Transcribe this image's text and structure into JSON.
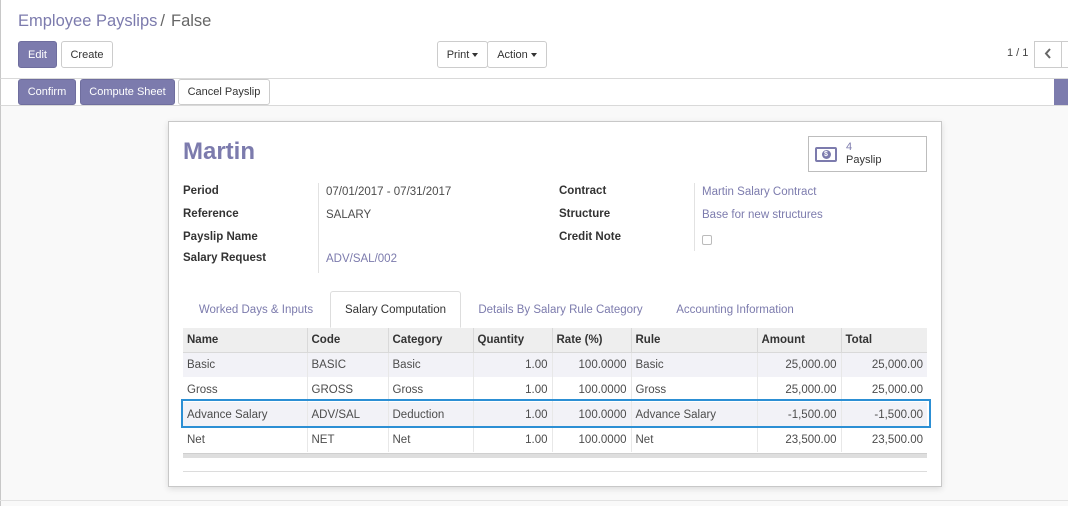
{
  "breadcrumb": {
    "parent": "Employee Payslips",
    "separator": "/",
    "current": "False"
  },
  "toolbar": {
    "edit_label": "Edit",
    "create_label": "Create",
    "print_label": "Print",
    "action_label": "Action"
  },
  "pager": {
    "value": "1 / 1",
    "prev_icon": "chevron-left-icon"
  },
  "status_buttons": {
    "confirm_label": "Confirm",
    "compute_label": "Compute Sheet",
    "cancel_label": "Cancel Payslip"
  },
  "colors": {
    "accent": "#7c7bad",
    "selection": "#2c8fd4"
  },
  "form": {
    "name": "Martin",
    "smart_button": {
      "icon": "money-icon",
      "count": "4",
      "label": "Payslip"
    },
    "fields": {
      "period_label": "Period",
      "period_value": "07/01/2017 - 07/31/2017",
      "reference_label": "Reference",
      "reference_value": "SALARY",
      "payslip_name_label": "Payslip Name",
      "payslip_name_value": "",
      "salary_request_label": "Salary Request",
      "salary_request_value": "ADV/SAL/002",
      "contract_label": "Contract",
      "contract_value": "Martin Salary Contract",
      "structure_label": "Structure",
      "structure_value": "Base for new structures",
      "credit_note_label": "Credit Note",
      "credit_note_checked": false
    },
    "tabs": [
      {
        "label": "Worked Days & Inputs",
        "active": false
      },
      {
        "label": "Salary Computation",
        "active": true
      },
      {
        "label": "Details By Salary Rule Category",
        "active": false
      },
      {
        "label": "Accounting Information",
        "active": false
      }
    ],
    "table": {
      "headers": [
        "Name",
        "Code",
        "Category",
        "Quantity",
        "Rate (%)",
        "Rule",
        "Amount",
        "Total"
      ],
      "rows": [
        [
          "Basic",
          "BASIC",
          "Basic",
          "1.00",
          "100.0000",
          "Basic",
          "25,000.00",
          "25,000.00"
        ],
        [
          "Gross",
          "GROSS",
          "Gross",
          "1.00",
          "100.0000",
          "Gross",
          "25,000.00",
          "25,000.00"
        ],
        [
          "Advance Salary",
          "ADV/SAL",
          "Deduction",
          "1.00",
          "100.0000",
          "Advance Salary",
          "-1,500.00",
          "-1,500.00"
        ],
        [
          "Net",
          "NET",
          "Net",
          "1.00",
          "100.0000",
          "Net",
          "23,500.00",
          "23,500.00"
        ]
      ],
      "selected_row": 2
    }
  }
}
